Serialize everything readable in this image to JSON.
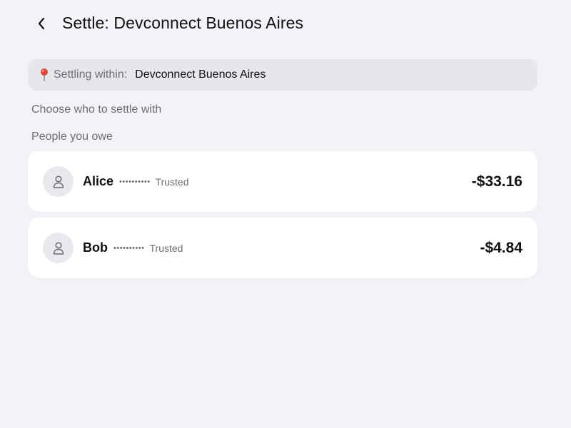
{
  "header": {
    "title": "Settle: Devconnect Buenos Aires",
    "back_icon": "chevron-left-icon"
  },
  "context": {
    "icon": "map-pin-icon",
    "icon_color": "#e0463b",
    "label": "Settling within:",
    "value": "Devconnect Buenos Aires"
  },
  "sections": {
    "choose_label": "Choose who to settle with",
    "owe_label": "People you owe"
  },
  "people": [
    {
      "name": "Alice",
      "masked_id": "••••••••••",
      "badge": "Trusted",
      "amount": "-$33.16",
      "avatar_icon": "user-icon"
    },
    {
      "name": "Bob",
      "masked_id": "••••••••••",
      "badge": "Trusted",
      "amount": "-$4.84",
      "avatar_icon": "user-icon"
    }
  ],
  "colors": {
    "background": "#f2f2f7",
    "card": "#ffffff",
    "banner": "#e6e6eb",
    "secondary_text": "#6d6d72",
    "primary_text": "#111111"
  }
}
